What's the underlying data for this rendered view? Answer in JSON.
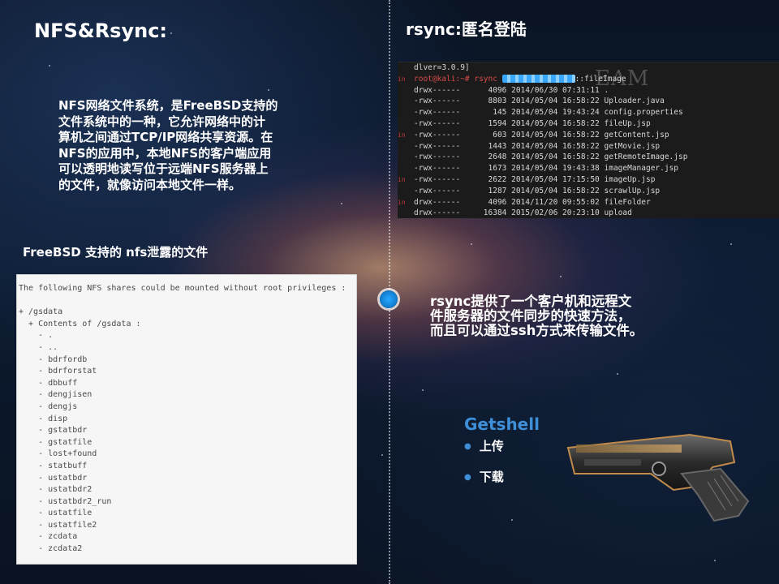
{
  "left": {
    "title": "NFS&Rsync:",
    "description": "NFS网络文件系统，是FreeBSD支持的\n文件系统中的一种，它允许网络中的计\n算机之间通过TCP/IP网络共享资源。在\nNFS的应用中，本地NFS的客户端应用\n可以透明地读写位于远端NFS服务器上\n的文件，就像访问本地文件一样。",
    "freebsd_heading": "FreeBSD 支持的 nfs泄露的文件",
    "terminal_lines": [
      "The following NFS shares could be mounted without root privileges :",
      "",
      "+ /gsdata",
      "  + Contents of /gsdata :",
      "    - .",
      "    - ..",
      "    - bdrfordb",
      "    - bdrforstat",
      "    - dbbuff",
      "    - dengjisen",
      "    - dengjs",
      "    - disp",
      "    - gstatbdr",
      "    - gstatfile",
      "    - lost+found",
      "    - statbuff",
      "    - ustatbdr",
      "    - ustatbdr2",
      "    - ustatbdr2_run",
      "    - ustatfile",
      "    - ustatfile2",
      "    - zcdata",
      "    - zcdata2"
    ]
  },
  "right": {
    "title": "rsync:匿名登陆",
    "console_watermark": "EAM",
    "console_lines": [
      {
        "gutter": "",
        "text": "dlver=3.0.9]"
      },
      {
        "gutter": "in",
        "text": "root@kali:~# rsync "
      },
      {
        "gutter": "",
        "text": "drwx------      4096 2014/06/30 07:31:11 ."
      },
      {
        "gutter": "",
        "text": "-rwx------      8803 2014/05/04 16:58:22 Uploader.java"
      },
      {
        "gutter": "",
        "text": "-rwx------       145 2014/05/04 19:43:24 config.properties"
      },
      {
        "gutter": "",
        "text": "-rwx------      1594 2014/05/04 16:58:22 fileUp.jsp"
      },
      {
        "gutter": "in",
        "text": "-rwx------       603 2014/05/04 16:58:22 getContent.jsp"
      },
      {
        "gutter": "",
        "text": "-rwx------      1443 2014/05/04 16:58:22 getMovie.jsp"
      },
      {
        "gutter": "",
        "text": "-rwx------      2648 2014/05/04 16:58:22 getRemoteImage.jsp"
      },
      {
        "gutter": "",
        "text": "-rwx------      1673 2014/05/04 19:43:38 imageManager.jsp"
      },
      {
        "gutter": "in",
        "text": "-rwx------      2622 2014/05/04 17:15:50 imageUp.jsp"
      },
      {
        "gutter": "",
        "text": "-rwx------      1287 2014/05/04 16:58:22 scrawlUp.jsp"
      },
      {
        "gutter": "in",
        "text": "drwx------      4096 2014/11/20 09:55:02 fileFolder"
      },
      {
        "gutter": "",
        "text": "drwx------     16384 2015/02/06 20:23:10 upload"
      }
    ],
    "console_cmd_suffix": "::fileImage",
    "rsync_desc": "rsync提供了一个客户机和远程文\n件服务器的文件同步的快速方法，\n而且可以通过ssh方式来传输文件。",
    "getshell": {
      "title": "Getshell",
      "items": [
        "上传",
        "下载"
      ]
    }
  }
}
